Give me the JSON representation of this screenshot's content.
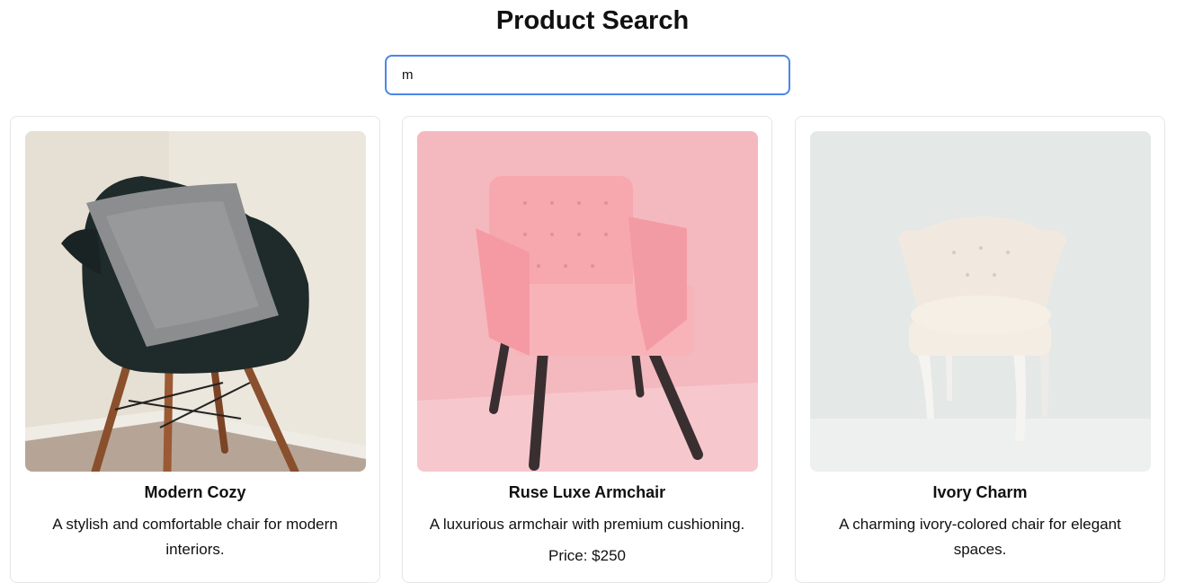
{
  "header": {
    "title": "Product Search"
  },
  "search": {
    "value": "m",
    "placeholder": ""
  },
  "products": [
    {
      "name": "Modern Cozy",
      "description": "A stylish and comfortable chair for modern interiors.",
      "image": "black-shell-chair-with-pillow"
    },
    {
      "name": "Ruse Luxe Armchair",
      "description": "A luxurious armchair with premium cushioning.",
      "price": "Price: $250",
      "image": "pink-tufted-armchair"
    },
    {
      "name": "Ivory Charm",
      "description": "A charming ivory-colored chair for elegant spaces.",
      "image": "ivory-tufted-chair"
    }
  ],
  "colors": {
    "accent": "#4a86e8",
    "card_border": "#e6e6e6"
  }
}
